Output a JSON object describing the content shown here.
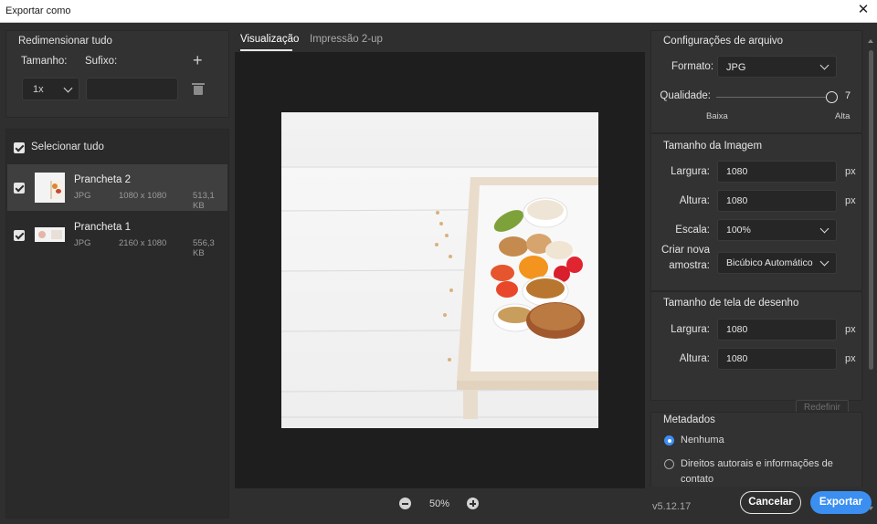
{
  "window": {
    "title": "Exportar como",
    "close_icon": "close-icon"
  },
  "left": {
    "resize_title": "Redimensionar tudo",
    "size_label": "Tamanho:",
    "suffix_label": "Sufixo:",
    "size_value": "1x",
    "suffix_value": "",
    "select_all_label": "Selecionar tudo",
    "items": [
      {
        "name": "Prancheta 2",
        "format": "JPG",
        "dimensions": "1080 x 1080",
        "filesize": "513,1 KB",
        "checked": true,
        "selected": true
      },
      {
        "name": "Prancheta 1",
        "format": "JPG",
        "dimensions": "2160 x 1080",
        "filesize": "556,3 KB",
        "checked": true,
        "selected": false
      }
    ]
  },
  "center": {
    "tabs": [
      {
        "label": "Visualização",
        "active": true
      },
      {
        "label": "Impressão 2-up",
        "active": false
      }
    ],
    "zoom": "50%"
  },
  "right": {
    "file_settings": {
      "title": "Configurações de arquivo",
      "format_label": "Formato:",
      "format_value": "JPG",
      "quality_label": "Qualidade:",
      "quality_value": "7",
      "quality_low": "Baixa",
      "quality_high": "Alta"
    },
    "image_size": {
      "title": "Tamanho da Imagem",
      "width_label": "Largura:",
      "width_value": "1080",
      "height_label": "Altura:",
      "height_value": "1080",
      "unit": "px",
      "scale_label": "Escala:",
      "scale_value": "100%",
      "resample_label_1": "Criar nova",
      "resample_label_2": "amostra:",
      "resample_value": "Bicúbico Automático"
    },
    "canvas_size": {
      "title": "Tamanho de tela de desenho",
      "width_label": "Largura:",
      "width_value": "1080",
      "height_label": "Altura:",
      "height_value": "1080",
      "unit": "px",
      "reset_label": "Redefinir"
    },
    "metadata": {
      "title": "Metadados",
      "option_none": "Nenhuma",
      "option_copyright_1": "Direitos autorais e informações de",
      "option_copyright_2": "contato"
    }
  },
  "footer": {
    "version": "v5.12.17",
    "cancel_label": "Cancelar",
    "export_label": "Exportar"
  },
  "colors": {
    "accent": "#3b8ff0",
    "background": "#2f2f2f",
    "preview_bg": "#1e1e1e"
  }
}
